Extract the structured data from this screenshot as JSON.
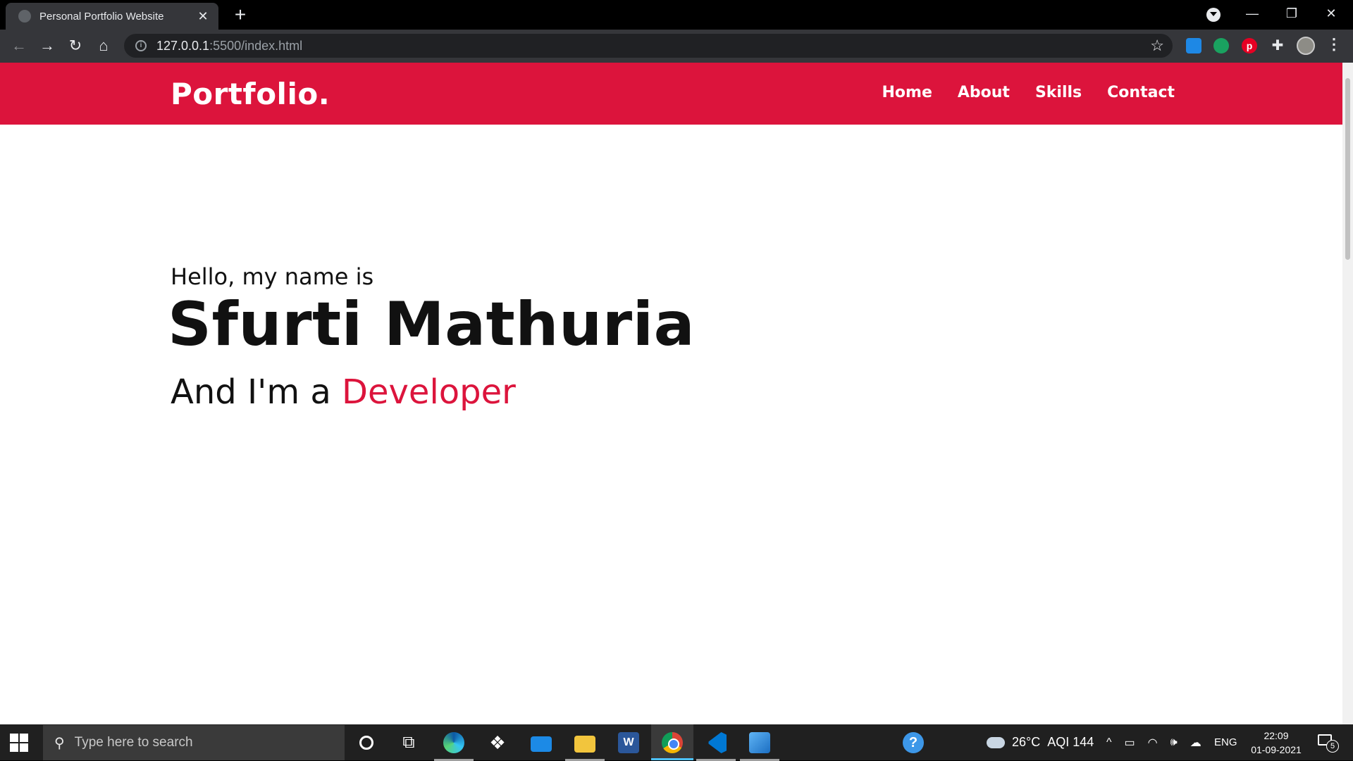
{
  "browser": {
    "tab_title": "Personal Portfolio Website",
    "tab_close": "✕",
    "new_tab": "+",
    "window_controls": {
      "minimize": "—",
      "maximize": "❐",
      "close": "✕"
    },
    "nav": {
      "back": "←",
      "forward": "→",
      "reload": "↻",
      "home": "⌂"
    },
    "info_icon": "i",
    "url_host": "127.0.0.1",
    "url_rest": ":5500/index.html",
    "bookmark_icon": "☆",
    "extensions": [
      "tabsearch-icon",
      "browser-ext-icon",
      "grammarly-icon",
      "pinterest-icon",
      "puzzle-icon"
    ],
    "pinterest_glyph": "p",
    "puzzle_glyph": "✚",
    "menu_glyph": "⋮"
  },
  "site": {
    "brand": "Portfolio.",
    "nav_links": [
      "Home",
      "About",
      "Skills",
      "Contact"
    ],
    "accent_color": "#dc143c",
    "hero": {
      "greeting": "Hello, my name is",
      "name": "Sfurti Mathuria",
      "role_prefix": "And I'm a ",
      "role_accent": "Developer"
    }
  },
  "taskbar": {
    "search_placeholder": "Type here to search",
    "search_glyph": "⚲",
    "taskview_glyph": "⧉",
    "dropbox_glyph": "❖",
    "word_glyph": "W",
    "help_glyph": "?",
    "apps": [
      "edge-icon",
      "dropbox-icon",
      "mail-icon",
      "file-explorer-icon",
      "word-icon",
      "chrome-icon",
      "vscode-icon",
      "photos-icon"
    ],
    "weather": {
      "temp": "26°C",
      "aqi": "AQI 144"
    },
    "tray": {
      "chevron": "^",
      "device": "▭",
      "wifi": "◠",
      "volume": "🕪",
      "onedrive": "☁"
    },
    "language": "ENG",
    "time": "22:09",
    "date": "01-09-2021",
    "notification_count": "5"
  }
}
